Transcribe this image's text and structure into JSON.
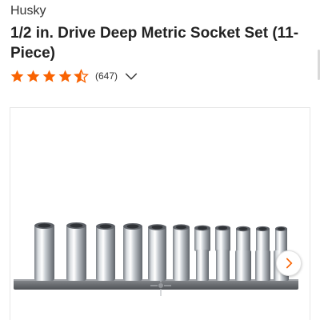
{
  "product": {
    "brand": "Husky",
    "title": "1/2 in. Drive Deep Metric Socket Set (11-Piece)"
  },
  "rating": {
    "stars": 4.5,
    "max_stars": 5,
    "count_label": "(647)",
    "star_color": "#f96302"
  },
  "gallery": {
    "image_icon": "socket-set-image",
    "next_icon": "chevron-right-icon",
    "next_color": "#f96302"
  }
}
